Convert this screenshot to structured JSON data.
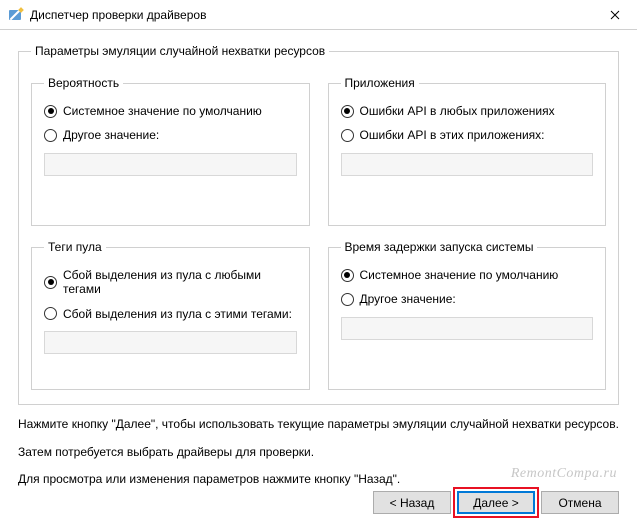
{
  "window": {
    "title": "Диспетчер проверки драйверов"
  },
  "outer": {
    "legend": "Параметры эмуляции случайной нехватки ресурсов"
  },
  "group_probability": {
    "legend": "Вероятность",
    "opt1": "Системное значение по умолчанию",
    "opt2": "Другое значение:"
  },
  "group_apps": {
    "legend": "Приложения",
    "opt1": "Ошибки API в любых приложениях",
    "opt2": "Ошибки API в этих приложениях:"
  },
  "group_tags": {
    "legend": "Теги пула",
    "opt1": "Сбой выделения из пула с любыми тегами",
    "opt2": "Сбой выделения из пула с этими тегами:"
  },
  "group_delay": {
    "legend": "Время задержки запуска системы",
    "opt1": "Системное значение по умолчанию",
    "opt2": "Другое значение:"
  },
  "instructions": {
    "line1": "Нажмите кнопку \"Далее\", чтобы использовать текущие параметры эмуляции случайной нехватки ресурсов.",
    "line2": "Затем потребуется выбрать драйверы для проверки.",
    "line3": "Для просмотра или изменения параметров нажмите кнопку \"Назад\"."
  },
  "buttons": {
    "back": "< Назад",
    "next": "Далее >",
    "cancel": "Отмена"
  },
  "watermark": "RemontCompa.ru"
}
